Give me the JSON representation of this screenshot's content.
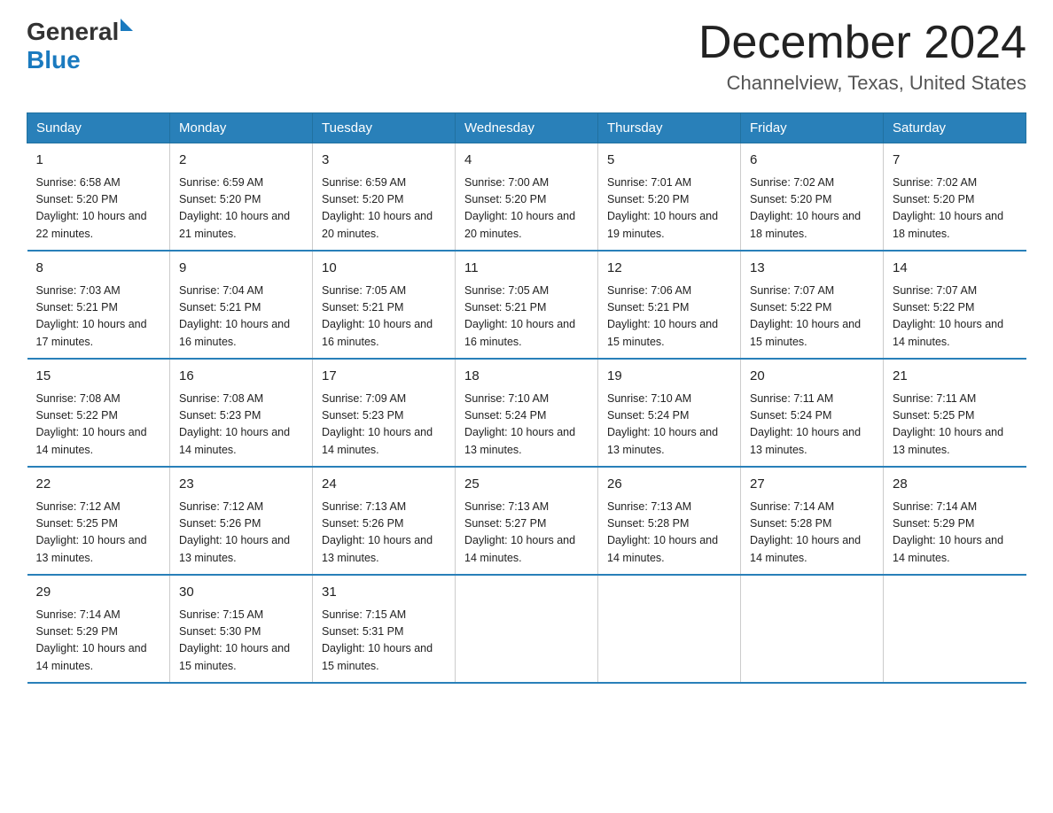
{
  "header": {
    "logo_general": "General",
    "logo_blue": "Blue",
    "month": "December 2024",
    "location": "Channelview, Texas, United States"
  },
  "days_of_week": [
    "Sunday",
    "Monday",
    "Tuesday",
    "Wednesday",
    "Thursday",
    "Friday",
    "Saturday"
  ],
  "weeks": [
    [
      {
        "day": "1",
        "sunrise": "6:58 AM",
        "sunset": "5:20 PM",
        "daylight": "10 hours and 22 minutes."
      },
      {
        "day": "2",
        "sunrise": "6:59 AM",
        "sunset": "5:20 PM",
        "daylight": "10 hours and 21 minutes."
      },
      {
        "day": "3",
        "sunrise": "6:59 AM",
        "sunset": "5:20 PM",
        "daylight": "10 hours and 20 minutes."
      },
      {
        "day": "4",
        "sunrise": "7:00 AM",
        "sunset": "5:20 PM",
        "daylight": "10 hours and 20 minutes."
      },
      {
        "day": "5",
        "sunrise": "7:01 AM",
        "sunset": "5:20 PM",
        "daylight": "10 hours and 19 minutes."
      },
      {
        "day": "6",
        "sunrise": "7:02 AM",
        "sunset": "5:20 PM",
        "daylight": "10 hours and 18 minutes."
      },
      {
        "day": "7",
        "sunrise": "7:02 AM",
        "sunset": "5:20 PM",
        "daylight": "10 hours and 18 minutes."
      }
    ],
    [
      {
        "day": "8",
        "sunrise": "7:03 AM",
        "sunset": "5:21 PM",
        "daylight": "10 hours and 17 minutes."
      },
      {
        "day": "9",
        "sunrise": "7:04 AM",
        "sunset": "5:21 PM",
        "daylight": "10 hours and 16 minutes."
      },
      {
        "day": "10",
        "sunrise": "7:05 AM",
        "sunset": "5:21 PM",
        "daylight": "10 hours and 16 minutes."
      },
      {
        "day": "11",
        "sunrise": "7:05 AM",
        "sunset": "5:21 PM",
        "daylight": "10 hours and 16 minutes."
      },
      {
        "day": "12",
        "sunrise": "7:06 AM",
        "sunset": "5:21 PM",
        "daylight": "10 hours and 15 minutes."
      },
      {
        "day": "13",
        "sunrise": "7:07 AM",
        "sunset": "5:22 PM",
        "daylight": "10 hours and 15 minutes."
      },
      {
        "day": "14",
        "sunrise": "7:07 AM",
        "sunset": "5:22 PM",
        "daylight": "10 hours and 14 minutes."
      }
    ],
    [
      {
        "day": "15",
        "sunrise": "7:08 AM",
        "sunset": "5:22 PM",
        "daylight": "10 hours and 14 minutes."
      },
      {
        "day": "16",
        "sunrise": "7:08 AM",
        "sunset": "5:23 PM",
        "daylight": "10 hours and 14 minutes."
      },
      {
        "day": "17",
        "sunrise": "7:09 AM",
        "sunset": "5:23 PM",
        "daylight": "10 hours and 14 minutes."
      },
      {
        "day": "18",
        "sunrise": "7:10 AM",
        "sunset": "5:24 PM",
        "daylight": "10 hours and 13 minutes."
      },
      {
        "day": "19",
        "sunrise": "7:10 AM",
        "sunset": "5:24 PM",
        "daylight": "10 hours and 13 minutes."
      },
      {
        "day": "20",
        "sunrise": "7:11 AM",
        "sunset": "5:24 PM",
        "daylight": "10 hours and 13 minutes."
      },
      {
        "day": "21",
        "sunrise": "7:11 AM",
        "sunset": "5:25 PM",
        "daylight": "10 hours and 13 minutes."
      }
    ],
    [
      {
        "day": "22",
        "sunrise": "7:12 AM",
        "sunset": "5:25 PM",
        "daylight": "10 hours and 13 minutes."
      },
      {
        "day": "23",
        "sunrise": "7:12 AM",
        "sunset": "5:26 PM",
        "daylight": "10 hours and 13 minutes."
      },
      {
        "day": "24",
        "sunrise": "7:13 AM",
        "sunset": "5:26 PM",
        "daylight": "10 hours and 13 minutes."
      },
      {
        "day": "25",
        "sunrise": "7:13 AM",
        "sunset": "5:27 PM",
        "daylight": "10 hours and 14 minutes."
      },
      {
        "day": "26",
        "sunrise": "7:13 AM",
        "sunset": "5:28 PM",
        "daylight": "10 hours and 14 minutes."
      },
      {
        "day": "27",
        "sunrise": "7:14 AM",
        "sunset": "5:28 PM",
        "daylight": "10 hours and 14 minutes."
      },
      {
        "day": "28",
        "sunrise": "7:14 AM",
        "sunset": "5:29 PM",
        "daylight": "10 hours and 14 minutes."
      }
    ],
    [
      {
        "day": "29",
        "sunrise": "7:14 AM",
        "sunset": "5:29 PM",
        "daylight": "10 hours and 14 minutes."
      },
      {
        "day": "30",
        "sunrise": "7:15 AM",
        "sunset": "5:30 PM",
        "daylight": "10 hours and 15 minutes."
      },
      {
        "day": "31",
        "sunrise": "7:15 AM",
        "sunset": "5:31 PM",
        "daylight": "10 hours and 15 minutes."
      },
      null,
      null,
      null,
      null
    ]
  ]
}
